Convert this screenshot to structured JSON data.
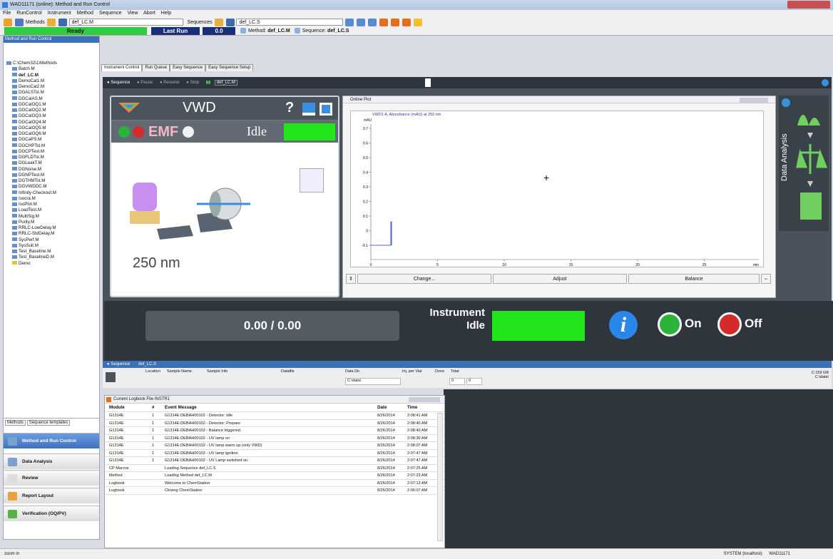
{
  "window": {
    "title": "WAD11171 (online): Method and Run Control"
  },
  "menu": [
    "File",
    "RunControl",
    "Instrument",
    "Method",
    "Sequence",
    "View",
    "Abort",
    "Help"
  ],
  "toolbar": {
    "methods_label": "Methods",
    "method_value": "def_LC.M",
    "sequences_label": "Sequences",
    "sequence_value": "def_LC.S"
  },
  "status": {
    "ready": "Ready",
    "last_run": "Last Run",
    "last_run_value": "0.0",
    "method_label": "Method:",
    "method_name": "def_LC.M",
    "sequence_label": "Sequence:",
    "sequence_name": "def_LC.S"
  },
  "left": {
    "header": "Method and Run Control",
    "root": "C:\\Chem32\\1\\Methods",
    "items": [
      "Batch.M",
      "def_LC.M",
      "DemoCal1.M",
      "DemoCal2.M",
      "DGALSTst.M",
      "DGCalAS.M",
      "DGCalOQ1.M",
      "DGCalOQ2.M",
      "DGCalOQ3.M",
      "DGCalOQ4.M",
      "DGCalOQ5.M",
      "DGCalOQ6.M",
      "DGCaPS.M",
      "DGCHPTst.M",
      "DGCPTest.M",
      "DGFLDTst.M",
      "DGLeakT.M",
      "DGNoise.M",
      "DGNPTest.M",
      "DGTHMTst.M",
      "DGVWDDC.M",
      "Infinity-Checkout.M",
      "Isocra.M",
      "IsoPlot.M",
      "LoadTest.M",
      "MultiSig.M",
      "Purity.M",
      "RRLC-LowDelay.M",
      "RRLC-StdDelay.M",
      "SysPerf.M",
      "SysSuit.M",
      "Test_Baseline.M",
      "Test_BaselineD.M",
      "Demo"
    ],
    "tab1": "Methods",
    "tab2": "Sequence templates",
    "nav": [
      "Method and Run Control",
      "Data Analysis",
      "Review",
      "Report Layout",
      "Verification (OQ/PV)"
    ]
  },
  "tabs": [
    "Instrument Control",
    "Run Queue",
    "Easy Sequence",
    "Easy Sequence Setup"
  ],
  "seqbar": {
    "sequence": "Sequence",
    "pause": "Pause",
    "resume": "Resume",
    "stop": "Stop",
    "method": "def_LC.M"
  },
  "vwd": {
    "title": "VWD",
    "help": "?",
    "emf": "EMF",
    "state": "Idle",
    "wavelength": "250 nm"
  },
  "plot": {
    "title": "Online Plot",
    "signal": "VWD1 A, Absorbance (mAU) at 250 nm",
    "yunit": "mAU",
    "xunit": "min",
    "yticks": [
      "0.7",
      "0.6",
      "0.5",
      "0.4",
      "0.3",
      "0.2",
      "0.1",
      "0",
      "-0.1"
    ],
    "xticks": [
      "0",
      "5",
      "10",
      "15",
      "20",
      "25"
    ],
    "change": "Change...",
    "adjust": "Adjust",
    "balance": "Balance"
  },
  "data_analysis": "Data Analysis",
  "bottom": {
    "counter": "0.00 / 0.00",
    "instrument": "Instrument",
    "idle": "Idle",
    "on": "On",
    "off": "Off",
    "info": "i"
  },
  "seq": {
    "title": "Sequence",
    "name": "def_LC.S",
    "cols": [
      "Location",
      "Sample Name",
      "Sample Info",
      "Datafile",
      "Data Dir.",
      "Inj. per Vial",
      "Done",
      "Total"
    ],
    "data_dir": "C:\\data\\",
    "done": "0",
    "total": "0",
    "disk": "C:159 GB",
    "path": "C:\\data\\"
  },
  "log": {
    "title": "Current Logbook File INSTR1",
    "headers": [
      "Module",
      "#",
      "Event Message",
      "Date",
      "Time"
    ],
    "rows": [
      [
        "G1314E",
        "1",
        "G1314E:DEBAH00102 - Detector: Idle",
        "8/26/2014",
        "2:08:41 AM"
      ],
      [
        "G1314E",
        "1",
        "G1314E:DEBAH00102 - Detector: Prepare",
        "8/26/2014",
        "2:08:40 AM"
      ],
      [
        "G1314E",
        "1",
        "G1314E:DEBAH00102 - Balance triggered.",
        "8/26/2014",
        "2:08:40 AM"
      ],
      [
        "G1314E",
        "1",
        "G1314E:DEBAH00102 - UV lamp on",
        "8/26/2014",
        "2:08:30 AM"
      ],
      [
        "G1314E",
        "1",
        "G1314E:DEBAH00102 - UV lamp warm up (only VWD)",
        "8/26/2014",
        "2:08:07 AM"
      ],
      [
        "G1314E",
        "1",
        "G1314E:DEBAH00102 - UV lamp ignition",
        "8/26/2014",
        "2:07:47 AM"
      ],
      [
        "G1314E",
        "1",
        "G1314E:DEBAH00102 - UV Lamp switched on.",
        "8/26/2014",
        "2:07:47 AM"
      ],
      [
        "CP Macros",
        "",
        "Loading Sequence def_LC.S",
        "8/26/2014",
        "2:07:25 AM"
      ],
      [
        "Method",
        "",
        "Loading Method def_LC.M",
        "8/26/2014",
        "2:07:23 AM"
      ],
      [
        "Logbook",
        "",
        "Welcome to ChemStation",
        "8/26/2014",
        "2:07:13 AM"
      ],
      [
        "Logbook",
        "",
        "Closing ChemStation",
        "8/26/2014",
        "2:06:07 AM"
      ]
    ]
  },
  "statusbar": {
    "left": "zoom in",
    "system": "SYSTEM (localhost)",
    "host": "WAD11171"
  }
}
